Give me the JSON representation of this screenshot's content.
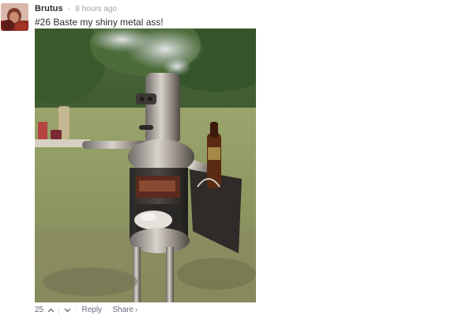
{
  "comment": {
    "author": "Brutus",
    "separator": "·",
    "timestamp": "8 hours ago",
    "text": "#26 Baste my shiny metal ass!",
    "image_alt": "Bender-shaped metal barbecue smoker with a beer bottle in a holder",
    "footer": {
      "vote_count": "25",
      "upvote_icon": "chevron-up-icon",
      "downvote_icon": "chevron-down-icon",
      "dot": "·",
      "reply_label": "Reply",
      "share_label": "Share",
      "share_caret": "›"
    }
  },
  "colors": {
    "author": "#2a2e2e",
    "meta": "#9aa4ab",
    "footer": "#656c7a"
  }
}
